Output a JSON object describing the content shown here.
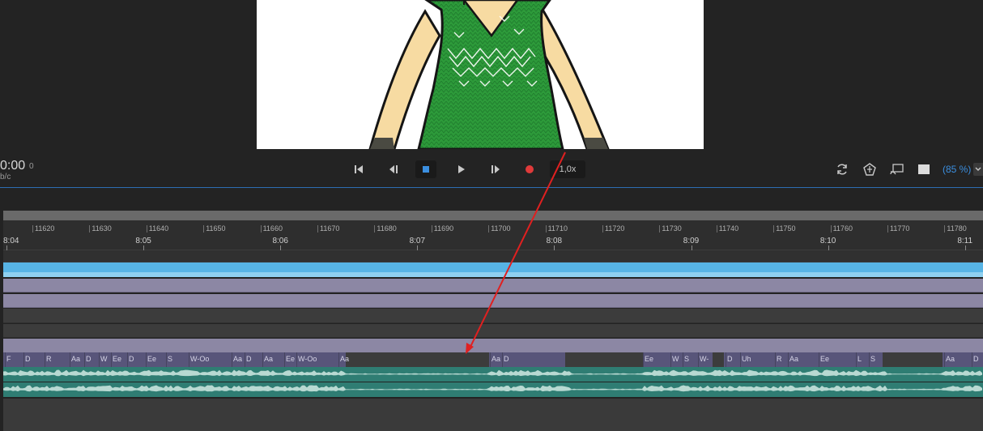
{
  "transport": {
    "timecode": "0:00",
    "timecode_sub": "0",
    "timecode_unit": "b/c",
    "speed": "1,0x",
    "zoom": "(85 %)"
  },
  "ruler": {
    "frames": [
      "11620",
      "11630",
      "11640",
      "11650",
      "11660",
      "11670",
      "11680",
      "11690",
      "11700",
      "11710",
      "11720",
      "11730",
      "11740",
      "11750",
      "11760",
      "11770",
      "11780"
    ],
    "times": [
      "8:04",
      "8:05",
      "8:06",
      "8:07",
      "8:08",
      "8:09",
      "8:10",
      "8:11"
    ]
  },
  "visemes": [
    "F",
    "D",
    "R",
    "Aa",
    "D",
    "W",
    "Ee",
    "D",
    "Ee",
    "S",
    "W-Oo",
    "Aa",
    "D",
    "Aa",
    "Ee",
    "W-Oo",
    "Aa",
    "Aa",
    "D",
    "Ee",
    "W",
    "S",
    "W-",
    "D",
    "Uh",
    "R",
    "Aa",
    "Ee",
    "L",
    "S",
    "Aa",
    "D"
  ],
  "icons": {
    "go_start": "skip-to-start-icon",
    "step_back": "step-back-icon",
    "stop": "stop-icon",
    "play": "play-icon",
    "step_forward": "step-forward-icon",
    "record": "record-icon",
    "refresh": "refresh-icon",
    "puppet": "puppet-icon",
    "cast": "cast-icon",
    "background": "background-swatch-icon"
  },
  "colors": {
    "accent_blue": "#3b8fe0",
    "record_red": "#e03a3a",
    "annotation_arrow": "#e02020",
    "track_blue": "#57b4e5",
    "track_purple": "#8c87a4",
    "audio_teal": "#2f7d73",
    "sweater_green": "#2d9a3a"
  }
}
